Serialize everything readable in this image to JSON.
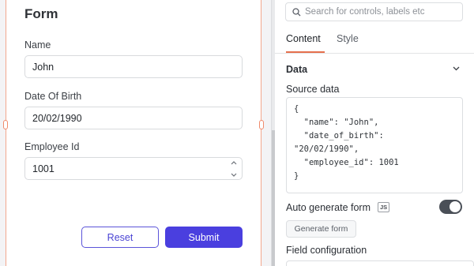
{
  "form": {
    "title": "Form",
    "fields": [
      {
        "label": "Name",
        "value": "John"
      },
      {
        "label": "Date Of Birth",
        "value": "20/02/1990"
      },
      {
        "label": "Employee Id",
        "value": "1001"
      }
    ],
    "reset_label": "Reset",
    "submit_label": "Submit"
  },
  "panel": {
    "search_placeholder": "Search for controls, labels etc",
    "tabs": [
      {
        "label": "Content",
        "active": true
      },
      {
        "label": "Style",
        "active": false
      }
    ],
    "section_title": "Data",
    "source_data_label": "Source data",
    "source_data_code": "{\n  \"name\": \"John\",\n  \"date_of_birth\":\n\"20/02/1990\",\n  \"employee_id\": 1001\n}",
    "auto_generate_label": "Auto generate form",
    "js_badge": "JS",
    "auto_generate_on": true,
    "generate_button": "Generate form",
    "field_config_label": "Field configuration"
  },
  "colors": {
    "accent": "#4a3fdf",
    "selection": "#f08a6b",
    "tab_active": "#e5704d"
  }
}
